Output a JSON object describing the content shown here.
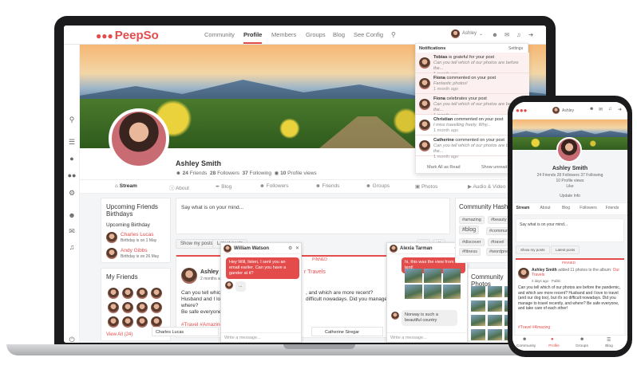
{
  "brand": {
    "name": "PeepSo",
    "color": "#e44c4c"
  },
  "nav": {
    "items": [
      "Community",
      "Profile",
      "Members",
      "Groups",
      "Blog",
      "See Config"
    ],
    "user": "Ashley"
  },
  "profile": {
    "name": "Ashley Smith",
    "friends": "24",
    "friends_label": "Friends",
    "followers": "28",
    "followers_label": "Followers",
    "following": "37",
    "following_label": "Following",
    "views": "10",
    "views_label": "Profile views"
  },
  "tabs": [
    "Stream",
    "About",
    "Blog",
    "Followers",
    "Friends",
    "Groups",
    "Photos",
    "Audio & Video"
  ],
  "notifications": {
    "title": "Notifications",
    "settings": "Settings",
    "items": [
      {
        "name": "Tobias",
        "text": "is grateful for your post",
        "sub": "Can you tell which of our photos are before the...",
        "time": "1 month ago"
      },
      {
        "name": "Fiona",
        "text": "commented on your post",
        "sub": "Fantastic photos!",
        "time": "1 month ago"
      },
      {
        "name": "Fiona",
        "text": "celebrates your post",
        "sub": "Can you tell which of our photos are before the...",
        "time": "1 month ago"
      },
      {
        "name": "Christian",
        "text": "commented on your post",
        "sub": "I miss travelling freely. Why...",
        "time": "1 month ago"
      },
      {
        "name": "Catherine",
        "text": "commented on your post",
        "sub": "Can you tell which of our photos are before the...",
        "time": "1 month ago"
      }
    ],
    "mark_all": "Mark All as Read",
    "show_unread": "Show unread only"
  },
  "birthdays": {
    "title": "Upcoming Friends Birthdays",
    "subtitle": "Upcoming Birthday",
    "people": [
      {
        "name": "Charles Lucas",
        "date": "Birthday is on 1 May"
      },
      {
        "name": "Andy Gibbs",
        "date": "Birthday is on 26 May"
      }
    ]
  },
  "friends": {
    "title": "My Friends",
    "view_all": "View All (24)"
  },
  "composer": {
    "placeholder": "Say what is on your mind...",
    "show_my_posts": "Show my posts",
    "latest_posts": "Latest posts"
  },
  "post": {
    "author": "Ashley Sm",
    "time": "2 months a",
    "album": "r Travels",
    "text1": "Can you tell which",
    "text2": "Husband and I love",
    "text3": "where?",
    "text4": "Be safe everyone, a",
    "text_right1": ", and which are more recent?",
    "text_right2": "difficult nowadays. Did you manage t",
    "tags": "#Travel #Amazing",
    "pinned": "PINNED"
  },
  "hashtags": {
    "title": "Community Hashtags",
    "items": [
      "#amazing",
      "#beauty",
      "#blog",
      "#community",
      "#discover",
      "#travel",
      "#fitness",
      "#wordpress"
    ]
  },
  "community_photos": {
    "title": "Community Photos"
  },
  "chats": [
    {
      "name": "William Watson",
      "msg1": "Hey Will, listen, I sent you an email earlier. Can you have a gander at it?",
      "msg2": "...",
      "input": "Write a message..."
    },
    {
      "name": "Alexia Tarman",
      "msg1": "hi, this was the view from our tent!",
      "msg2": "Norway is such a beautiful country",
      "input": "Write a message..."
    }
  ],
  "chatbar": {
    "left": "Charles Lucas",
    "right": "Catherine Siregar"
  },
  "phone": {
    "user": "Ashley",
    "name": "Ashley Smith",
    "stats": "24 Friends  28 Followers  37 Following",
    "views": "10 Profile views",
    "like": "Like",
    "update": "Update Info",
    "tabs": [
      "Stream",
      "About",
      "Blog",
      "Followers",
      "Friends"
    ],
    "composer": "Say what is on your mind...",
    "show": "Show my posts",
    "latest": "Latest posts",
    "pinned": "PINNED",
    "post_author": "Ashley Smith",
    "post_action": "added 11 photos to the album:",
    "post_album": "Our Travels",
    "post_time": "2 days ago",
    "post_privacy": "Public",
    "post_text": "Can you tell which of our photos are before the pandemic, and which are more recent? Husband and I love to travel (and our dog too), but it's so difficult nowadays. Did you manage to travel recently, and where? Be safe everyone, and take care of each other!",
    "post_tags": "#Travel #Amazing",
    "bottom": [
      "Community",
      "Profile",
      "Groups",
      "Blog"
    ]
  }
}
